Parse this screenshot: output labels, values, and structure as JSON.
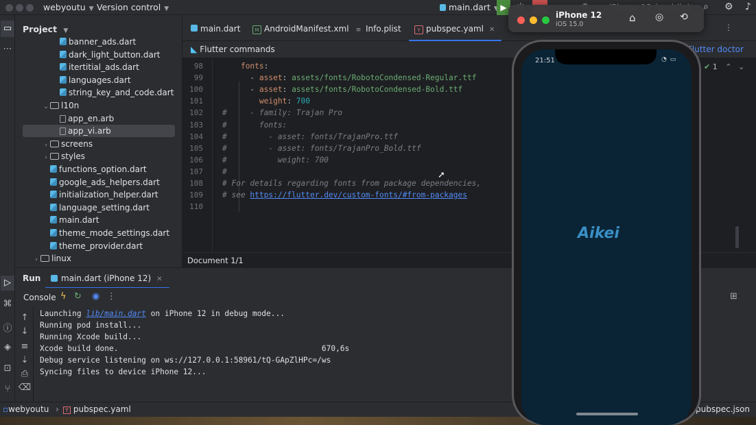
{
  "titlebar": {
    "project_name": "webyoutu",
    "vcs_label": "Version control",
    "run_config": "main.dart",
    "device_label": "iPhone 12 (mobile)"
  },
  "project_panel": {
    "title": "Project",
    "items": [
      {
        "label": "banner_ads.dart",
        "type": "dart",
        "indent": 3,
        "arrow": ""
      },
      {
        "label": "dark_light_button.dart",
        "type": "dart",
        "indent": 3,
        "arrow": ""
      },
      {
        "label": "itertitial_ads.dart",
        "type": "dart",
        "indent": 3,
        "arrow": ""
      },
      {
        "label": "languages.dart",
        "type": "dart",
        "indent": 3,
        "arrow": ""
      },
      {
        "label": "string_key_and_code.dart",
        "type": "dart",
        "indent": 3,
        "arrow": ""
      },
      {
        "label": "l10n",
        "type": "folder",
        "indent": 2,
        "arrow": "expanded"
      },
      {
        "label": "app_en.arb",
        "type": "arb",
        "indent": 3,
        "arrow": ""
      },
      {
        "label": "app_vi.arb",
        "type": "arb",
        "indent": 3,
        "arrow": "",
        "selected": true
      },
      {
        "label": "screens",
        "type": "folder",
        "indent": 2,
        "arrow": "collapsed"
      },
      {
        "label": "styles",
        "type": "folder",
        "indent": 2,
        "arrow": "collapsed"
      },
      {
        "label": "functions_option.dart",
        "type": "dart",
        "indent": 2,
        "arrow": ""
      },
      {
        "label": "google_ads_helpers.dart",
        "type": "dart",
        "indent": 2,
        "arrow": ""
      },
      {
        "label": "initialization_helper.dart",
        "type": "dart",
        "indent": 2,
        "arrow": ""
      },
      {
        "label": "language_setting.dart",
        "type": "dart",
        "indent": 2,
        "arrow": ""
      },
      {
        "label": "main.dart",
        "type": "dart",
        "indent": 2,
        "arrow": ""
      },
      {
        "label": "theme_mode_settings.dart",
        "type": "dart",
        "indent": 2,
        "arrow": ""
      },
      {
        "label": "theme_provider.dart",
        "type": "dart",
        "indent": 2,
        "arrow": ""
      },
      {
        "label": "linux",
        "type": "folder",
        "indent": 1,
        "arrow": "collapsed"
      }
    ]
  },
  "editor_tabs": [
    {
      "label": "main.dart",
      "icon": "dart-file-icon",
      "active": false
    },
    {
      "label": "AndroidManifest.xml",
      "icon": "manifest-file-icon",
      "active": false
    },
    {
      "label": "Info.plist",
      "icon": "plist-file-icon",
      "active": false
    },
    {
      "label": "pubspec.yaml",
      "icon": "yaml-file-icon",
      "active": true
    }
  ],
  "flutter_bar": {
    "commands_label": "Flutter commands",
    "doctor_label": "Flutter doctor",
    "inspection_count": "1"
  },
  "code_lines": [
    {
      "num": "98",
      "text": "    fonts:"
    },
    {
      "num": "99",
      "text": "      - asset: assets/fonts/RobotoCondensed-Regular.ttf"
    },
    {
      "num": "100",
      "text": "      - asset: assets/fonts/RobotoCondensed-Bold.ttf"
    },
    {
      "num": "101",
      "text": "        weight: 700"
    },
    {
      "num": "102",
      "text": "#     - family: Trajan Pro"
    },
    {
      "num": "103",
      "text": "#       fonts:"
    },
    {
      "num": "104",
      "text": "#         - asset: fonts/TrajanPro.ttf"
    },
    {
      "num": "105",
      "text": "#         - asset: fonts/TrajanPro_Bold.ttf"
    },
    {
      "num": "106",
      "text": "#           weight: 700"
    },
    {
      "num": "107",
      "text": "#"
    },
    {
      "num": "108",
      "text": "# For details regarding fonts from package dependencies,"
    },
    {
      "num": "109",
      "text": "# see https://flutter.dev/custom-fonts/#from-packages"
    },
    {
      "num": "110",
      "text": ""
    }
  ],
  "doc_status": "Document 1/1",
  "run_panel": {
    "run_label": "Run",
    "run_tab": "main.dart (iPhone 12)",
    "console_label": "Console"
  },
  "console_lines": [
    {
      "prefix": "Launching ",
      "link": "lib/main.dart",
      "suffix": " on iPhone 12 in debug mode..."
    },
    {
      "prefix": "Running pod install...",
      "link": "",
      "suffix": ""
    },
    {
      "prefix": "Running Xcode build...",
      "link": "",
      "suffix": ""
    },
    {
      "prefix": "Xcode build done.                                            670,6s",
      "link": "",
      "suffix": ""
    },
    {
      "prefix": "Debug service listening on ws://127.0.0.1:58961/tQ-GApZlHPc=/ws",
      "link": "",
      "suffix": ""
    },
    {
      "prefix": "Syncing files to device iPhone 12...",
      "link": "",
      "suffix": ""
    }
  ],
  "statusbar": {
    "project": "webyoutu",
    "file": "pubspec.yaml",
    "right_file": "pubspec.json"
  },
  "simulator": {
    "device_name": "iPhone 12",
    "os_version": "iOS 15.0",
    "time": "21:51",
    "app_logo": "Aikei",
    "screen_color": "#0a2436",
    "logo_color": "#3a8fc4"
  }
}
